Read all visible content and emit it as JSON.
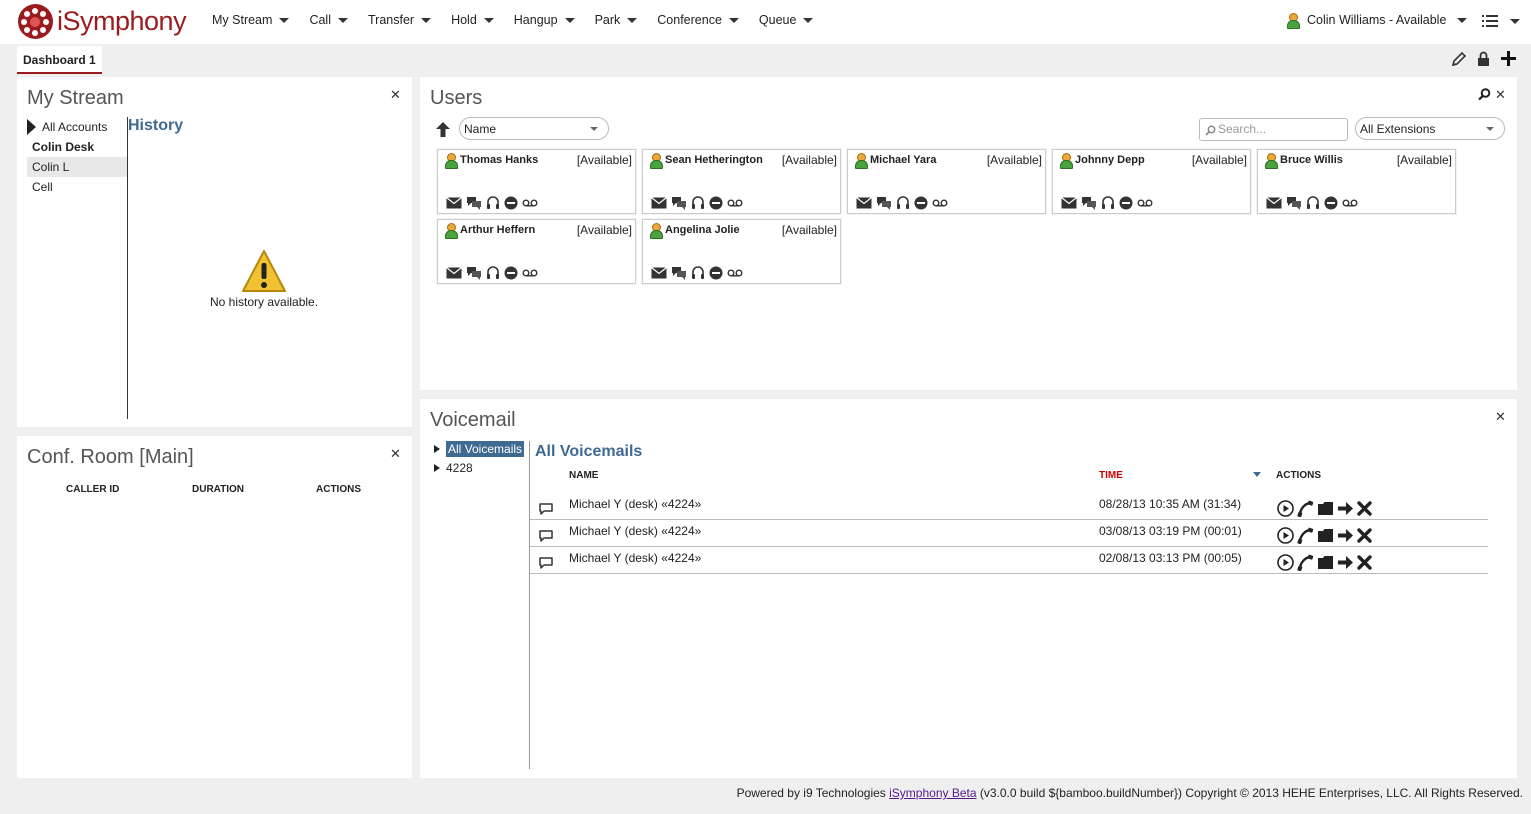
{
  "app": {
    "name": "iSymphony"
  },
  "menu": [
    {
      "label": "My Stream"
    },
    {
      "label": "Call"
    },
    {
      "label": "Transfer"
    },
    {
      "label": "Hold"
    },
    {
      "label": "Hangup"
    },
    {
      "label": "Park"
    },
    {
      "label": "Conference"
    },
    {
      "label": "Queue"
    }
  ],
  "user_status": "Colin Williams - Available",
  "tabs": [
    {
      "label": "Dashboard 1"
    }
  ],
  "my_stream": {
    "title": "My Stream",
    "accounts": [
      "All Accounts",
      "Colin Desk",
      "Colin L",
      "Cell"
    ],
    "history_title": "History",
    "empty_text": "No history available."
  },
  "users": {
    "title": "Users",
    "sort_select": "Name",
    "search_placeholder": "Search...",
    "filter_select": "All Extensions",
    "list": [
      {
        "name": "Thomas Hanks",
        "status": "[Available]"
      },
      {
        "name": "Sean Hetherington",
        "status": "[Available]"
      },
      {
        "name": "Michael Yara",
        "status": "[Available]"
      },
      {
        "name": "Johnny Depp",
        "status": "[Available]"
      },
      {
        "name": "Bruce Willis",
        "status": "[Available]"
      },
      {
        "name": "Arthur Heffern",
        "status": "[Available]"
      },
      {
        "name": "Angelina Jolie",
        "status": "[Available]"
      }
    ]
  },
  "conf_room": {
    "title": "Conf. Room [Main]",
    "columns": [
      "CALLER ID",
      "DURATION",
      "ACTIONS"
    ]
  },
  "voicemail": {
    "title": "Voicemail",
    "tree": [
      "All Voicemails",
      "4228"
    ],
    "list_title": "All Voicemails",
    "columns": {
      "name": "NAME",
      "time": "TIME",
      "actions": "ACTIONS"
    },
    "rows": [
      {
        "name": "Michael Y (desk) «4224»",
        "time": "08/28/13 10:35 AM (31:34)"
      },
      {
        "name": "Michael Y (desk) «4224»",
        "time": "03/08/13 03:19 PM (00:01)"
      },
      {
        "name": "Michael Y (desk) «4224»",
        "time": "02/08/13 03:13 PM (00:05)"
      }
    ]
  },
  "footer": {
    "prefix": "Powered by i9 Technologies",
    "link": "iSymphony Beta",
    "suffix": "(v3.0.0 build ${bamboo.buildNumber}) Copyright © 2013 HEHE Enterprises, LLC. All Rights Reserved."
  },
  "colors": {
    "brand": "#9b1b1e",
    "accent_blue": "#3f6a92",
    "time_header": "#cc0000"
  }
}
